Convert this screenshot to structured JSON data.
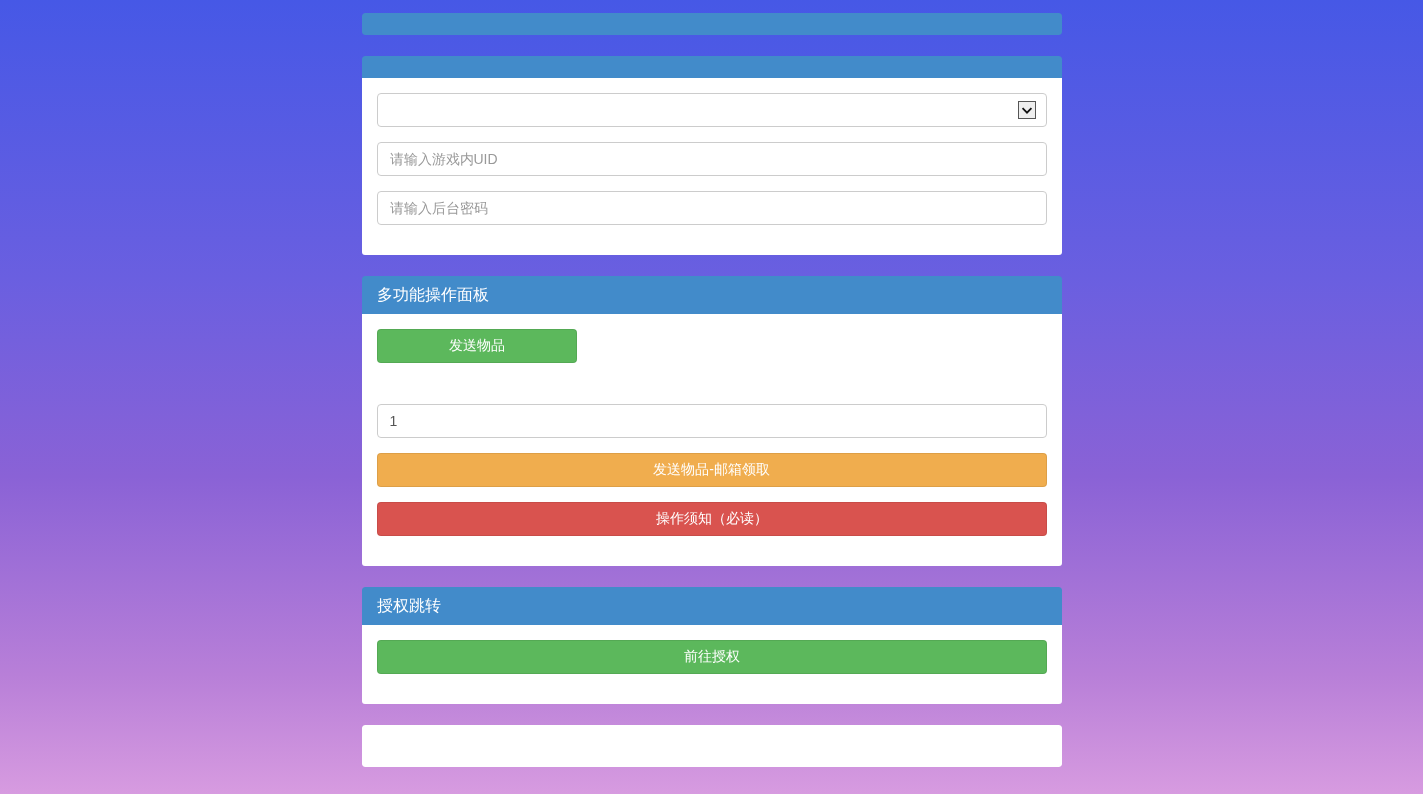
{
  "panels": [
    {
      "kind": "header-only"
    },
    {
      "kind": "panel",
      "items": [
        {
          "kind": "select"
        },
        {
          "kind": "input",
          "placeholder": "请输入游戏内UID"
        },
        {
          "kind": "input",
          "placeholder": "请输入后台密码"
        }
      ]
    },
    {
      "kind": "panel",
      "title": "多功能操作面板",
      "items": [
        {
          "kind": "button",
          "label": "发送物品",
          "color": "#5cb85c"
        },
        {
          "kind": "input",
          "value": "1"
        },
        {
          "kind": "block-button",
          "label": "发送物品-邮箱领取",
          "color": "#f0ad4e"
        },
        {
          "kind": "block-button",
          "label": "操作须知（必读）",
          "color": "#d9534f"
        }
      ]
    },
    {
      "kind": "panel",
      "title": "授权跳转",
      "items": [
        {
          "kind": "block-button",
          "label": "前往授权",
          "color": "#5cb85c"
        }
      ]
    },
    {
      "kind": "body-only"
    }
  ]
}
